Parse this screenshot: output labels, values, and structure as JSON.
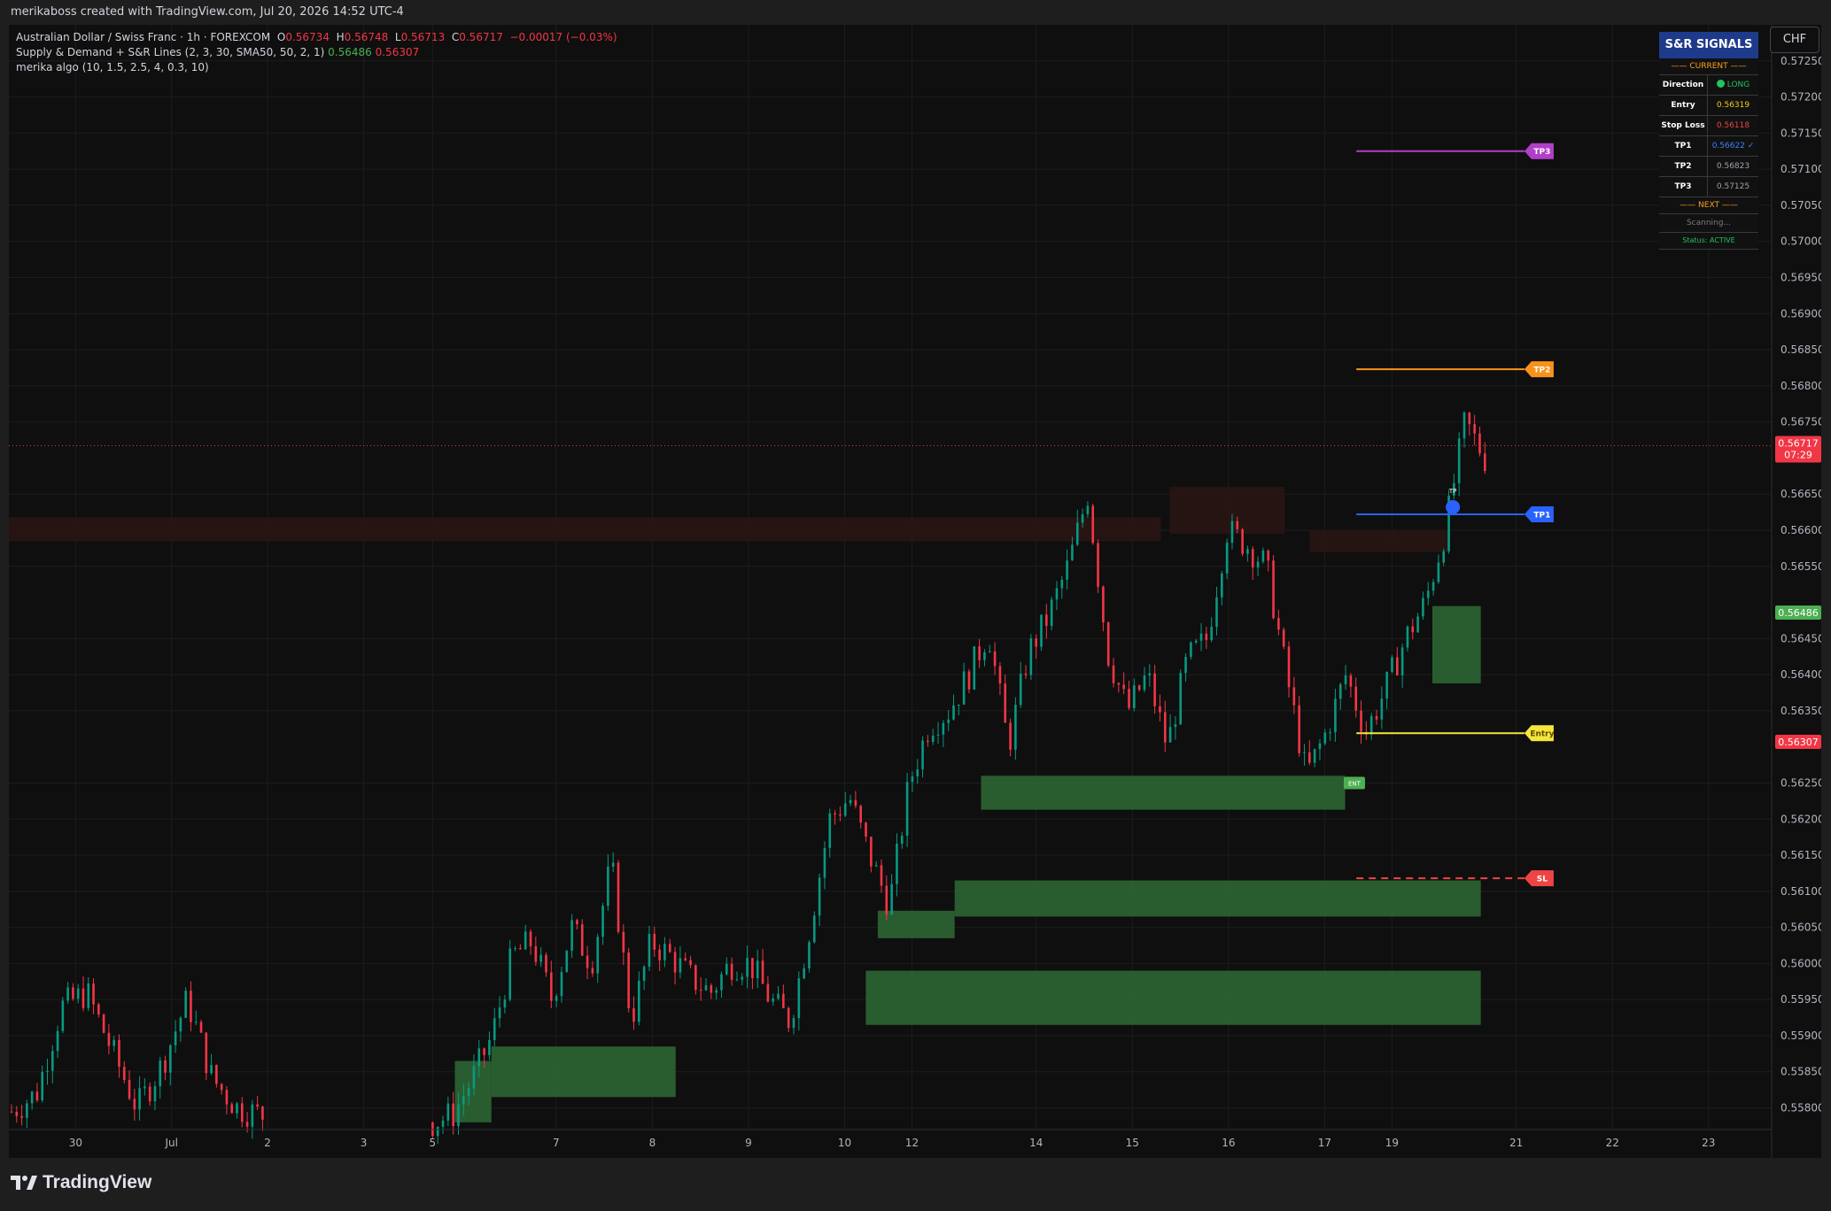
{
  "header": {
    "text": "merikaboss created with TradingView.com, Jul 20, 2026 14:52 UTC-4"
  },
  "legend": {
    "symbol": "Australian Dollar / Swiss Franc · 1h · FOREXCOM",
    "o_label": "O",
    "o": "0.56734",
    "h_label": "H",
    "h": "0.56748",
    "l_label": "L",
    "l": "0.56713",
    "c_label": "C",
    "c": "0.56717",
    "change": "−0.00017 (−0.03%)",
    "ind1": "Supply & Demand + S&R Lines (2, 3, 30, SMA50, 50, 2, 1)",
    "ind1_v1": "0.56486",
    "ind1_v2": "0.56307",
    "ind2": "merika algo (10, 1.5, 2.5, 4, 0.3, 10)"
  },
  "currency_button": "CHF",
  "signals": {
    "title": "S&R SIGNALS",
    "current": "—— CURRENT ——",
    "rows": [
      {
        "k": "Direction",
        "v": "LONG",
        "color": "#22c55e",
        "dot": true
      },
      {
        "k": "Entry",
        "v": "0.56319",
        "color": "#facc15"
      },
      {
        "k": "Stop Loss",
        "v": "0.56118",
        "color": "#ef4444"
      },
      {
        "k": "TP1",
        "v": "0.56622 ✓",
        "color": "#3b82f6"
      },
      {
        "k": "TP2",
        "v": "0.56823",
        "color": "#9ca3af"
      },
      {
        "k": "TP3",
        "v": "0.57125",
        "color": "#9ca3af"
      }
    ],
    "next": "—— NEXT ——",
    "scanning": "Scanning...",
    "status": "Status: ACTIVE"
  },
  "brand": "TradingView",
  "chart_data": {
    "type": "candlestick",
    "symbol": "AUDCHF",
    "timeframe": "1h",
    "ylim": [
      0.5577,
      0.573
    ],
    "y_ticks": [
      "0.57250",
      "0.57200",
      "0.57150",
      "0.57100",
      "0.57050",
      "0.57000",
      "0.56950",
      "0.56900",
      "0.56850",
      "0.56800",
      "0.56750",
      "0.56650",
      "0.56600",
      "0.56550",
      "0.56450",
      "0.56400",
      "0.56350",
      "0.56250",
      "0.56200",
      "0.56150",
      "0.56100",
      "0.56050",
      "0.56000",
      "0.55950",
      "0.55900",
      "0.55850",
      "0.55800"
    ],
    "x_ticks": [
      {
        "label": "30",
        "x": 0.0375
      },
      {
        "label": "Jul",
        "x": 0.0914
      },
      {
        "label": "2",
        "x": 0.1453
      },
      {
        "label": "3",
        "x": 0.1993
      },
      {
        "label": "5",
        "x": 0.238
      },
      {
        "label": "7",
        "x": 0.3074
      },
      {
        "label": "8",
        "x": 0.3614
      },
      {
        "label": "9",
        "x": 0.4154
      },
      {
        "label": "10",
        "x": 0.4694
      },
      {
        "label": "12",
        "x": 0.5072
      },
      {
        "label": "14",
        "x": 0.577
      },
      {
        "label": "15",
        "x": 0.631
      },
      {
        "label": "16",
        "x": 0.685
      },
      {
        "label": "17",
        "x": 0.739
      },
      {
        "label": "19",
        "x": 0.7768
      },
      {
        "label": "21",
        "x": 0.8466
      },
      {
        "label": "22",
        "x": 0.9006
      },
      {
        "label": "23",
        "x": 0.9546
      }
    ],
    "last_price": {
      "value": 0.56717,
      "label": "0.56717",
      "countdown": "07:29",
      "color": "#f23645"
    },
    "price_labels": [
      {
        "value": 0.56486,
        "label": "0.56486",
        "color": "#4caf50"
      },
      {
        "value": 0.56307,
        "label": "0.56307",
        "color": "#f23645"
      }
    ],
    "levels": [
      {
        "name": "TP3",
        "value": 0.57125,
        "color": "#b040c8",
        "style": "solid"
      },
      {
        "name": "TP2",
        "value": 0.56823,
        "color": "#f7931a",
        "style": "solid"
      },
      {
        "name": "TP1",
        "value": 0.56622,
        "color": "#2962ff",
        "style": "solid"
      },
      {
        "name": "Entry",
        "value": 0.56319,
        "color": "#f5e63c",
        "style": "solid"
      },
      {
        "name": "SL",
        "value": 0.56118,
        "color": "#ef4444",
        "style": "dashed"
      }
    ],
    "level_range_x": [
      0.7568,
      0.8512
    ],
    "demand_zones": [
      {
        "x0": 0.2505,
        "x1": 0.271,
        "y0": 0.5578,
        "y1": 0.55865
      },
      {
        "x0": 0.271,
        "x1": 0.3745,
        "y0": 0.55815,
        "y1": 0.55885
      },
      {
        "x0": 0.4813,
        "x1": 0.8267,
        "y0": 0.55915,
        "y1": 0.5599
      },
      {
        "x0": 0.488,
        "x1": 0.5312,
        "y0": 0.56035,
        "y1": 0.56073
      },
      {
        "x0": 0.5312,
        "x1": 0.8267,
        "y0": 0.56065,
        "y1": 0.56115
      },
      {
        "x0": 0.546,
        "x1": 0.7505,
        "y0": 0.56213,
        "y1": 0.5626
      },
      {
        "x0": 0.7995,
        "x1": 0.8267,
        "y0": 0.56388,
        "y1": 0.56495
      }
    ],
    "supply_zones": [
      {
        "x0": 0.0,
        "x1": 0.647,
        "y0": 0.56585,
        "y1": 0.56618
      },
      {
        "x0": 0.652,
        "x1": 0.7165,
        "y0": 0.56595,
        "y1": 0.5666
      },
      {
        "x0": 0.7305,
        "x1": 0.808,
        "y0": 0.5657,
        "y1": 0.566
      }
    ],
    "markers": [
      {
        "type": "tp-hit",
        "label": "TP",
        "x": 0.811,
        "y": 0.56632,
        "color": "#2962ff"
      },
      {
        "type": "entry-signal",
        "label": "ENT",
        "x": 0.7557,
        "y": 0.5625,
        "color": "#4caf50"
      }
    ],
    "series": [
      {
        "name": "AUDCHF",
        "segment": "jun29-jul1",
        "x0": 0.0015,
        "x1": 0.1425,
        "path": [
          0.55795,
          0.5582,
          0.5594,
          0.5596,
          0.5588,
          0.558,
          0.5586,
          0.5595,
          0.5584,
          0.558,
          0.5579
        ]
      },
      {
        "name": "AUDCHF",
        "segment": "jul3-jul20",
        "x0": 0.238,
        "x1": 0.829,
        "path": [
          0.5578,
          0.5579,
          0.5584,
          0.559,
          0.5601,
          0.5603,
          0.5595,
          0.5605,
          0.56,
          0.5614,
          0.5592,
          0.5603,
          0.5601,
          0.5598,
          0.5596,
          0.56,
          0.56,
          0.5595,
          0.5592,
          0.5605,
          0.562,
          0.5623,
          0.5615,
          0.5608,
          0.5625,
          0.5633,
          0.5635,
          0.564,
          0.5646,
          0.563,
          0.5643,
          0.5648,
          0.5655,
          0.5665,
          0.5643,
          0.5635,
          0.564,
          0.563,
          0.5642,
          0.5645,
          0.566,
          0.5658,
          0.5655,
          0.564,
          0.5626,
          0.5632,
          0.564,
          0.5632,
          0.5638,
          0.5645,
          0.565,
          0.566,
          0.5675,
          0.567
        ]
      }
    ],
    "grid": true
  }
}
